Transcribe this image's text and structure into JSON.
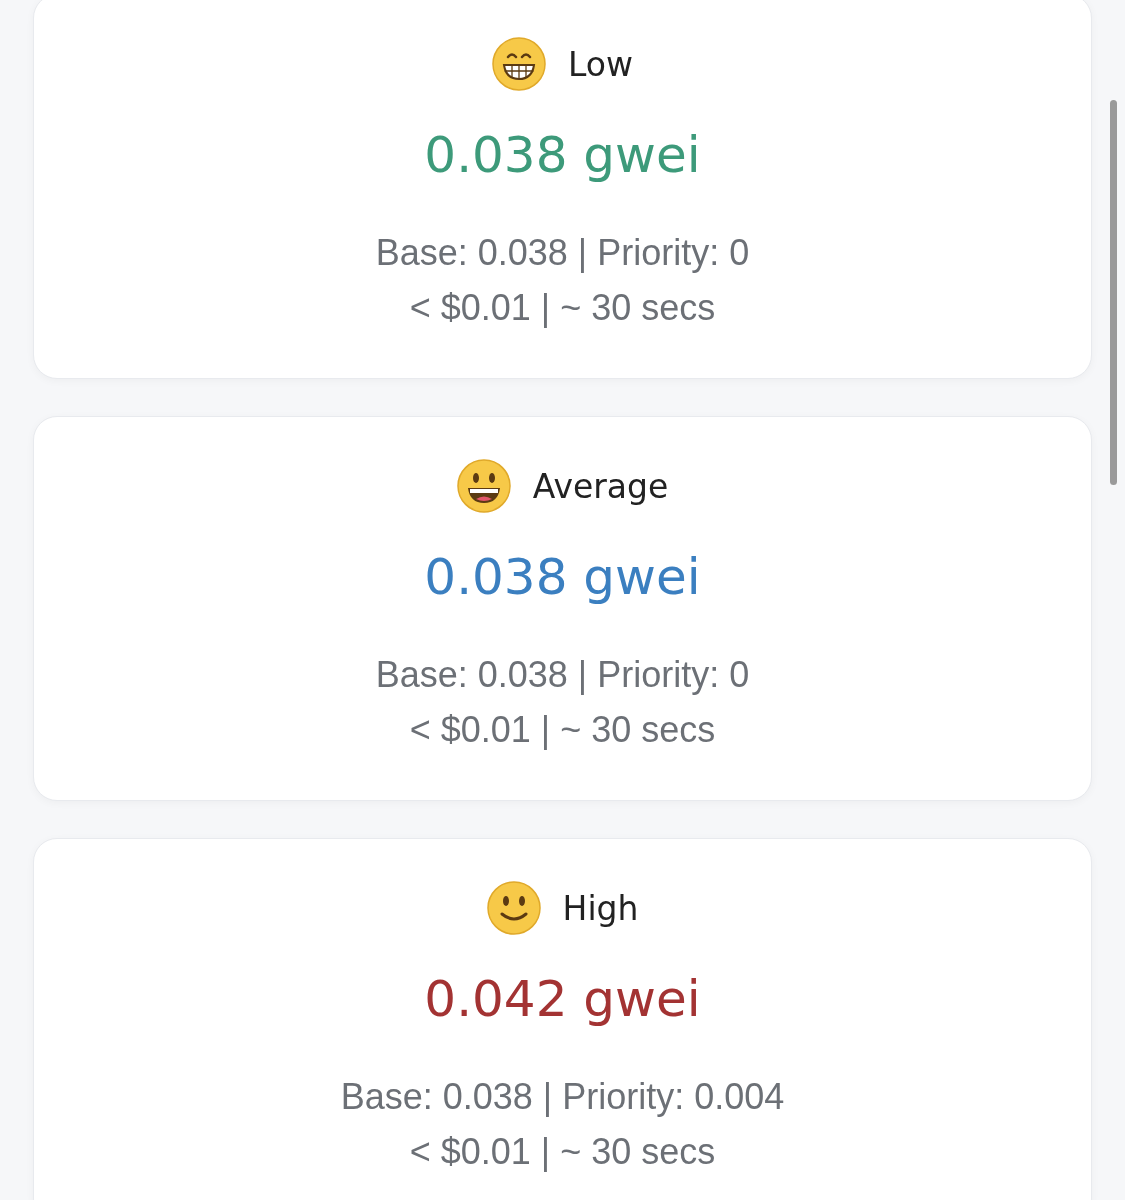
{
  "fee_levels": [
    {
      "kind": "grin",
      "label": "Low",
      "price": "0.038 gwei",
      "color": "#3d9a7a",
      "breakdown": "Base: 0.038 | Priority: 0",
      "estimate": "< $0.01 | ~ 30 secs"
    },
    {
      "kind": "open-smile",
      "label": "Average",
      "price": "0.038 gwei",
      "color": "#3b7fc0",
      "breakdown": "Base: 0.038 | Priority: 0",
      "estimate": "< $0.01 | ~ 30 secs"
    },
    {
      "kind": "smile",
      "label": "High",
      "price": "0.042 gwei",
      "color": "#a33333",
      "breakdown": "Base: 0.038 | Priority: 0.004",
      "estimate": "< $0.01 | ~ 30 secs"
    }
  ]
}
